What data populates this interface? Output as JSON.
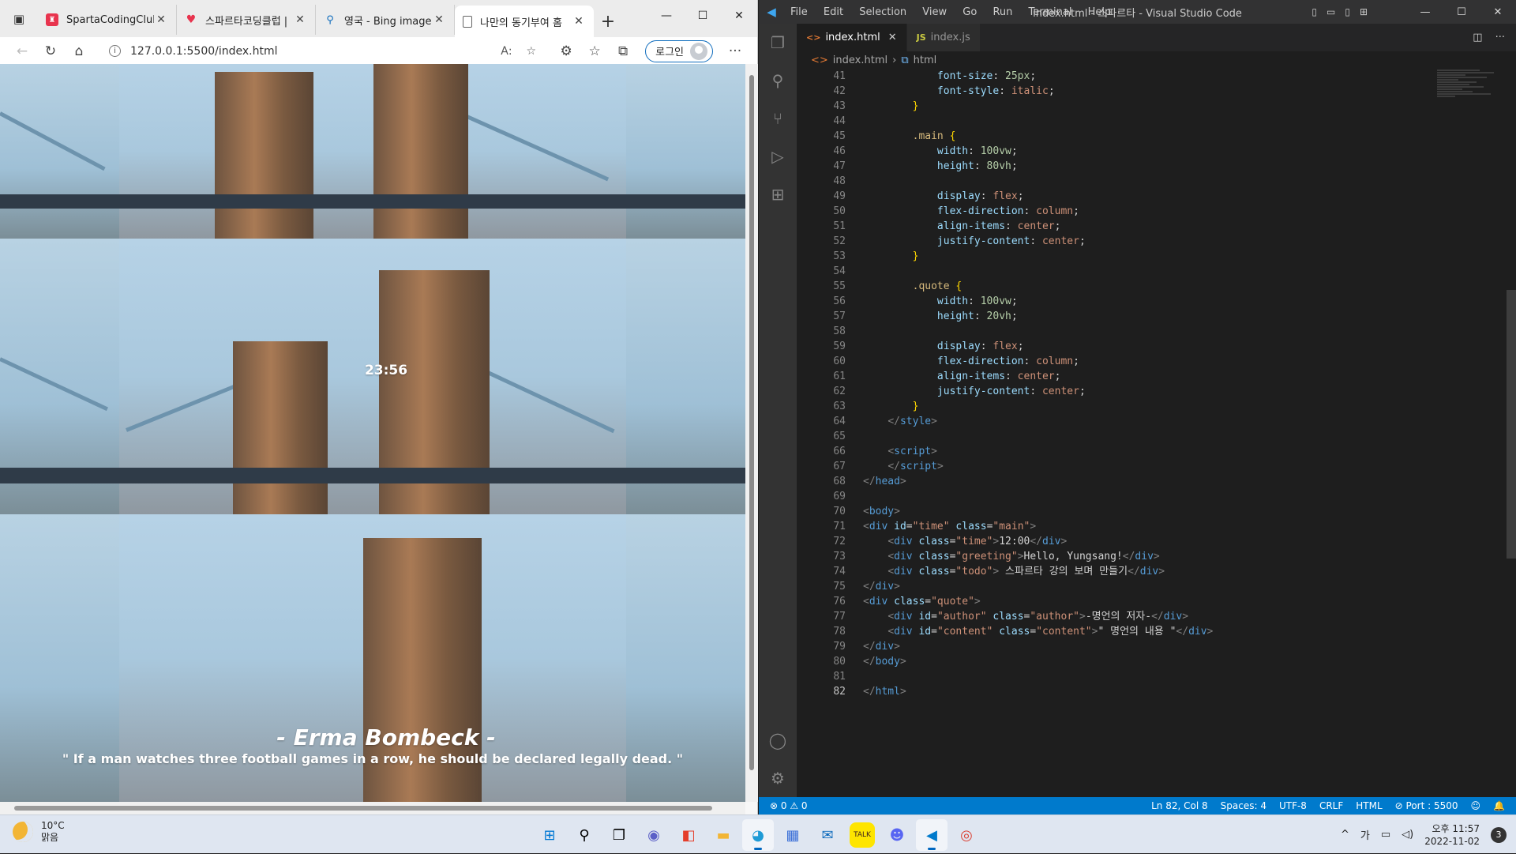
{
  "browser": {
    "tabs": [
      {
        "title": "SpartaCodingClub",
        "favicon": "sparta-icon",
        "color": "#e8344e"
      },
      {
        "title": "스파르타코딩클럽 | ",
        "favicon": "heart-icon",
        "color": "#e8344e"
      },
      {
        "title": "영국 - Bing images",
        "favicon": "search-icon",
        "color": "#0f6cbd"
      },
      {
        "title": "나만의 동기부여 홈",
        "favicon": "page-icon",
        "color": "#666666"
      }
    ],
    "url": "127.0.0.1:5500/index.html",
    "login_label": "로그인",
    "page": {
      "time": "23:56",
      "author": "- Erma Bombeck -",
      "quote": "\" If a man watches three football games in a row, he should be declared legally dead. \""
    }
  },
  "vscode": {
    "menu": [
      "File",
      "Edit",
      "Selection",
      "View",
      "Go",
      "Run",
      "Terminal",
      "Help"
    ],
    "window_title": "index.html - 스파르타 - Visual Studio Code",
    "tabs": [
      {
        "label": "index.html",
        "icon": "<>",
        "icon_color": "#e37933"
      },
      {
        "label": "index.js",
        "icon": "JS",
        "icon_color": "#cbcb41"
      }
    ],
    "breadcrumb": {
      "file": "index.html",
      "symbol": "html"
    },
    "status": {
      "errors": "0",
      "warnings": "0",
      "position": "Ln 82, Col 8",
      "spaces": "Spaces: 4",
      "encoding": "UTF-8",
      "eol": "CRLF",
      "language": "HTML",
      "port": "Port : 5500"
    }
  },
  "taskbar": {
    "temperature": "10°C",
    "weather": "맑음",
    "ime": "가",
    "time": "오후 11:57",
    "date": "2022-11-02",
    "notifications": "3"
  },
  "colors": {
    "accent": "#007acc",
    "edge_blue": "#0f6cbd"
  }
}
